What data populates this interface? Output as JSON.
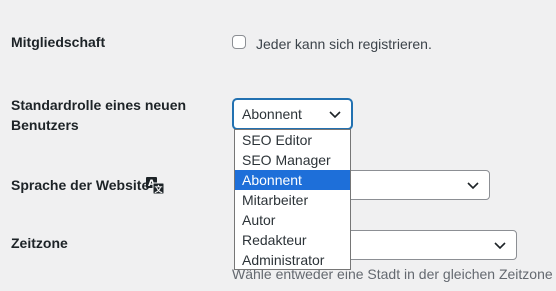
{
  "membership": {
    "label": "Mitgliedschaft",
    "checkbox_label": "Jeder kann sich registrieren."
  },
  "default_role": {
    "label_line1": "Standardrolle eines neuen",
    "label_line2": "Benutzers",
    "selected": "Abonnent",
    "options": [
      "SEO Editor",
      "SEO Manager",
      "Abonnent",
      "Mitarbeiter",
      "Autor",
      "Redakteur",
      "Administrator"
    ]
  },
  "site_language": {
    "label": "Sprache der Website",
    "icon": "translate-icon"
  },
  "timezone": {
    "label": "Zeitzone",
    "description": "Wähle entweder eine Stadt in der gleichen Zeitzone w"
  }
}
